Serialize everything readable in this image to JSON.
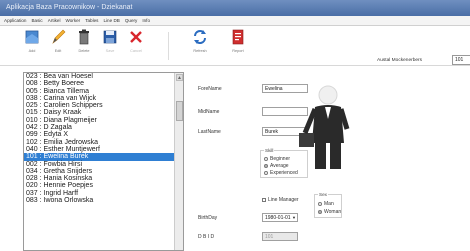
{
  "window": {
    "title": "Aplikacja Baza Pracownikow - Dziekanat"
  },
  "menu": [
    "Application",
    "Basic",
    "Artikel",
    "Worker",
    "Tables",
    "Line DB",
    "Query",
    "Info"
  ],
  "toolbar": [
    {
      "label": "Add",
      "icon": "add-icon",
      "disabled": false
    },
    {
      "label": "Edit",
      "icon": "edit-icon",
      "disabled": false
    },
    {
      "label": "Delete",
      "icon": "delete-icon",
      "disabled": false
    },
    {
      "label": "Save",
      "icon": "save-icon",
      "disabled": true
    },
    {
      "label": "Cancel",
      "icon": "cancel-icon",
      "disabled": true
    },
    {
      "label": "Refresh",
      "icon": "refresh-icon",
      "disabled": false
    },
    {
      "label": "Report",
      "icon": "report-icon",
      "disabled": false
    }
  ],
  "total": {
    "label": "Austal Mockenerbers",
    "value": "101"
  },
  "employees": [
    {
      "text": "023 : Bea  van Hoesel",
      "selected": false
    },
    {
      "text": "008 : Betty  Boeree",
      "selected": false
    },
    {
      "text": "005 : Bianca  Tillema",
      "selected": false
    },
    {
      "text": "038 : Carina  van Wijck",
      "selected": false
    },
    {
      "text": "025 : Carolien  Schippers",
      "selected": false
    },
    {
      "text": "015 : Daisy  Kraak",
      "selected": false
    },
    {
      "text": "010 : Diana  Plagmeijer",
      "selected": false
    },
    {
      "text": "042 : D  Zagala",
      "selected": false
    },
    {
      "text": "099 : Edyta  X",
      "selected": false
    },
    {
      "text": "102 : Emilia  Jedrowska",
      "selected": false
    },
    {
      "text": "040 : Esther  Muntjewerf",
      "selected": false
    },
    {
      "text": "101 : Ewelina  Burek",
      "selected": true
    },
    {
      "text": "002 : Fowbia  Hirsi",
      "selected": false
    },
    {
      "text": "034 : Gretha  Snijders",
      "selected": false
    },
    {
      "text": "028 : Hania  Kosinska",
      "selected": false
    },
    {
      "text": "020 : Hennie  Poepjes",
      "selected": false
    },
    {
      "text": "037 : Ingrid  Harff",
      "selected": false
    },
    {
      "text": "083 : Iwona  Orlowska",
      "selected": false
    }
  ],
  "form": {
    "forename_label": "ForeName",
    "forename_value": "Ewelina",
    "midname_label": "MidName",
    "midname_value": "",
    "lastname_label": "LastName",
    "lastname_value": "Burek",
    "skill_title": "Skill",
    "skill_options": [
      "Beginner",
      "Average",
      "Experienced"
    ],
    "skill_selected": "Average",
    "line_manager_label": "Line Manager",
    "sex_title": "Sex",
    "sex_options": [
      "Man",
      "Woman"
    ],
    "sex_selected": "Woman",
    "birthday_label": "BirthDay",
    "birthday_value": "1980-01-01",
    "dbid_label": "D B I D",
    "dbid_value": "101"
  }
}
